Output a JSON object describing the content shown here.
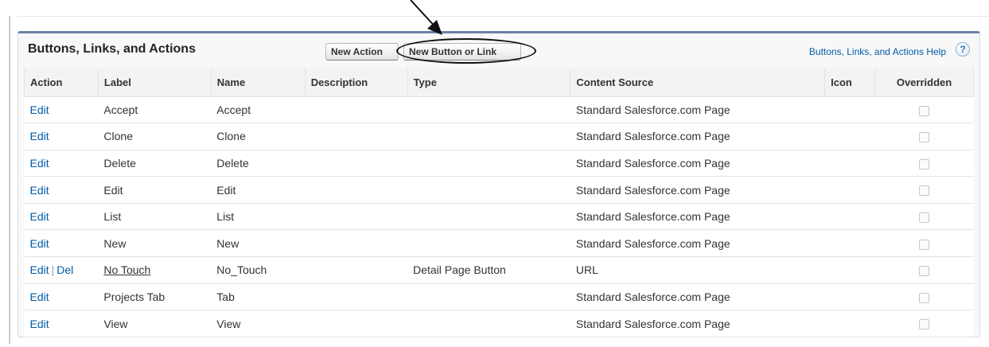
{
  "section": {
    "title": "Buttons, Links, and Actions",
    "new_action_label": "New Action",
    "new_button_label": "New Button or Link",
    "help_link": "Buttons, Links, and Actions Help",
    "help_icon": "?"
  },
  "colors": {
    "link": "#015ba7",
    "header_bar": "#6d7fa8",
    "header_bg": "#f2f3f3"
  },
  "table": {
    "columns": [
      "Action",
      "Label",
      "Name",
      "Description",
      "Type",
      "Content Source",
      "Icon",
      "Overridden"
    ],
    "rows": [
      {
        "edit": "Edit",
        "del": "",
        "label": "Accept",
        "label_link": false,
        "name": "Accept",
        "description": "",
        "type": "",
        "content_source": "Standard Salesforce.com Page",
        "icon": "",
        "overridden": false
      },
      {
        "edit": "Edit",
        "del": "",
        "label": "Clone",
        "label_link": false,
        "name": "Clone",
        "description": "",
        "type": "",
        "content_source": "Standard Salesforce.com Page",
        "icon": "",
        "overridden": false
      },
      {
        "edit": "Edit",
        "del": "",
        "label": "Delete",
        "label_link": false,
        "name": "Delete",
        "description": "",
        "type": "",
        "content_source": "Standard Salesforce.com Page",
        "icon": "",
        "overridden": false
      },
      {
        "edit": "Edit",
        "del": "",
        "label": "Edit",
        "label_link": false,
        "name": "Edit",
        "description": "",
        "type": "",
        "content_source": "Standard Salesforce.com Page",
        "icon": "",
        "overridden": false
      },
      {
        "edit": "Edit",
        "del": "",
        "label": "List",
        "label_link": false,
        "name": "List",
        "description": "",
        "type": "",
        "content_source": "Standard Salesforce.com Page",
        "icon": "",
        "overridden": false
      },
      {
        "edit": "Edit",
        "del": "",
        "label": "New",
        "label_link": false,
        "name": "New",
        "description": "",
        "type": "",
        "content_source": "Standard Salesforce.com Page",
        "icon": "",
        "overridden": false
      },
      {
        "edit": "Edit",
        "del": "Del",
        "label": "No Touch",
        "label_link": true,
        "name": "No_Touch",
        "description": "",
        "type": "Detail Page Button",
        "content_source": "URL",
        "icon": "",
        "overridden": false
      },
      {
        "edit": "Edit",
        "del": "",
        "label": "Projects Tab",
        "label_link": false,
        "name": "Tab",
        "description": "",
        "type": "",
        "content_source": "Standard Salesforce.com Page",
        "icon": "",
        "overridden": false
      },
      {
        "edit": "Edit",
        "del": "",
        "label": "View",
        "label_link": false,
        "name": "View",
        "description": "",
        "type": "",
        "content_source": "Standard Salesforce.com Page",
        "icon": "",
        "overridden": false
      }
    ]
  }
}
